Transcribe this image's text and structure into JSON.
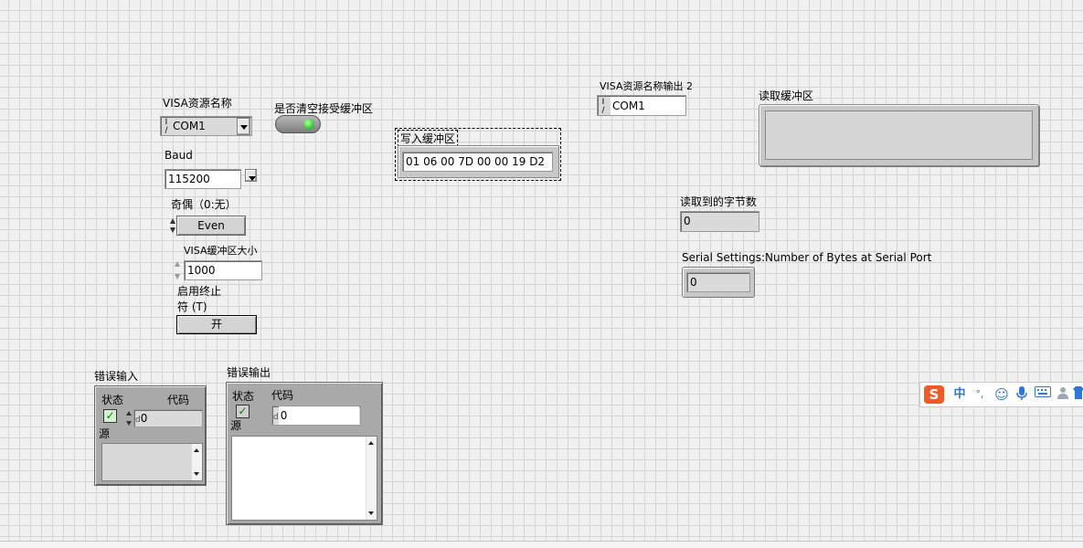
{
  "visa_resource": {
    "label": "VISA资源名称",
    "value": "COM1",
    "io_prefix": "I/O"
  },
  "clear_buffer": {
    "label": "是否清空接受缓冲区"
  },
  "baud": {
    "label": "Baud",
    "value": "115200"
  },
  "parity": {
    "label": "奇偶（0:无）",
    "value": "Even"
  },
  "visa_buffer_size": {
    "label": "VISA缓冲区大小",
    "value": "1000"
  },
  "enable_term": {
    "label_line1": "启用终止",
    "label_line2": "符 (T)",
    "value": "开"
  },
  "write_buffer": {
    "label": "写入缓冲区",
    "value": "01 06 00 7D 00 00 19 D2"
  },
  "visa_output": {
    "label": "VISA资源名称输出 2",
    "value": "COM1"
  },
  "read_buffer": {
    "label": "读取缓冲区",
    "value": ""
  },
  "bytes_read": {
    "label": "读取到的字节数",
    "value": "0"
  },
  "serial_bytes": {
    "label": "Serial Settings:Number of Bytes at Serial Port",
    "value": "0"
  },
  "error_in": {
    "label": "错误输入",
    "status_label": "状态",
    "code_label": "代码",
    "code_value": "0",
    "code_prefix": "d",
    "source_label": "源"
  },
  "error_out": {
    "label": "错误输出",
    "status_label": "状态",
    "code_label": "代码",
    "code_value": "0",
    "code_prefix": "d",
    "source_label": "源"
  },
  "ime_toolbar": {
    "logo": "S",
    "mode": "中",
    "punct": "°,",
    "icons": [
      "smiley-icon",
      "microphone-icon",
      "keyboard-icon",
      "user-icon",
      "shirt-icon"
    ]
  },
  "colors": {
    "led_green": "#3cc83c",
    "checkbox_green": "#0a7d0a",
    "ime_accent": "#2f77d2",
    "ime_logo": "#f05a28"
  }
}
